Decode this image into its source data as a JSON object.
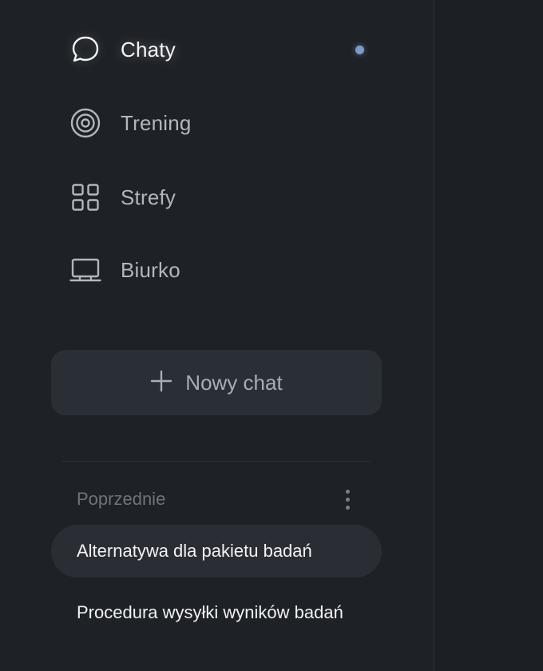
{
  "sidebar": {
    "nav": {
      "chats": {
        "label": "Chaty",
        "icon": "chat-bubble-icon",
        "active": true,
        "unread": true
      },
      "training": {
        "label": "Trening",
        "icon": "target-icon"
      },
      "zones": {
        "label": "Strefy",
        "icon": "grid-icon"
      },
      "desk": {
        "label": "Biurko",
        "icon": "laptop-icon"
      }
    },
    "new_chat": {
      "label": "Nowy chat",
      "icon": "plus-icon"
    },
    "history": {
      "title": "Poprzednie",
      "more_icon": "more-vertical-icon",
      "items": [
        {
          "label": "Alternatywa dla pakietu badań",
          "selected": true
        },
        {
          "label": "Procedura wysyłki wyników badań",
          "selected": false
        }
      ]
    }
  },
  "colors": {
    "background": "#1e2126",
    "text_active": "#f3f4f6",
    "text_inactive": "#b3b6bb",
    "accent_dot": "#7d9bc9",
    "button_bg": "#2a2e35"
  }
}
